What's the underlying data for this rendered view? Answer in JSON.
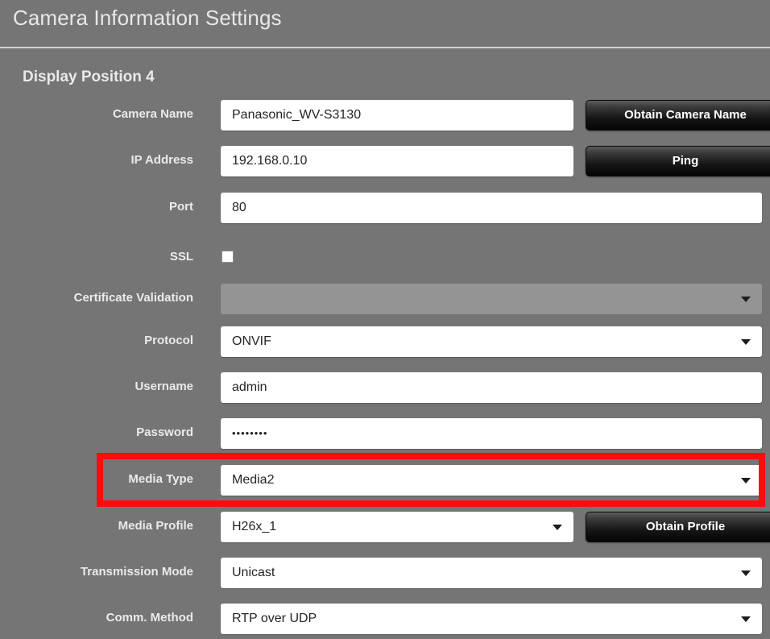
{
  "window": {
    "title": "Camera Information Settings"
  },
  "section": {
    "header": "Display Position 4"
  },
  "form": {
    "camera_name": {
      "label": "Camera Name",
      "value": "Panasonic_WV-S3130"
    },
    "ip_address": {
      "label": "IP Address",
      "value": "192.168.0.10"
    },
    "port": {
      "label": "Port",
      "value": "80"
    },
    "ssl": {
      "label": "SSL",
      "checked": false
    },
    "certificate_validation": {
      "label": "Certificate Validation",
      "value": "",
      "disabled": true
    },
    "protocol": {
      "label": "Protocol",
      "value": "ONVIF"
    },
    "username": {
      "label": "Username",
      "value": "admin"
    },
    "password": {
      "label": "Password",
      "value": "••••••••"
    },
    "media_type": {
      "label": "Media Type",
      "value": "Media2",
      "highlighted": true
    },
    "media_profile": {
      "label": "Media Profile",
      "value": "H26x_1"
    },
    "transmission_mode": {
      "label": "Transmission Mode",
      "value": "Unicast"
    },
    "comm_method": {
      "label": "Comm. Method",
      "value": "RTP over UDP"
    }
  },
  "buttons": {
    "obtain_camera_name": "Obtain Camera Name",
    "ping": "Ping",
    "obtain_profile": "Obtain Profile"
  },
  "colors": {
    "background": "#757575",
    "highlight": "#fc0d0d",
    "field_background": "#ffffff",
    "button_dark": "#161616",
    "label_text": "#eaeaea"
  }
}
